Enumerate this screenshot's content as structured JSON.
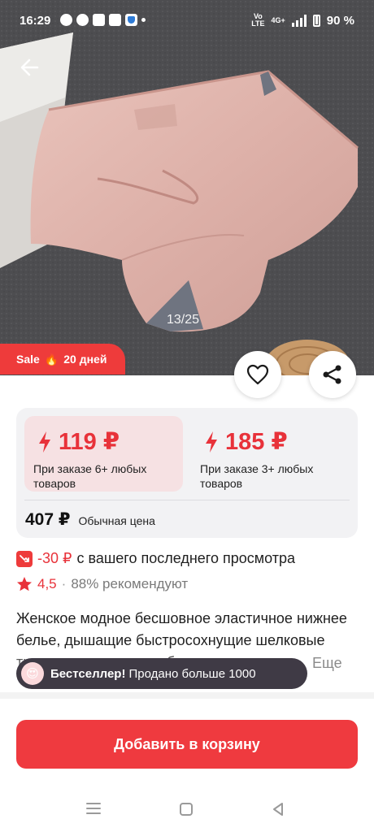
{
  "status_bar": {
    "time": "16:29",
    "volte_top": "Vo",
    "volte_bottom": "LTE",
    "network": "4G+",
    "battery": "90 %"
  },
  "gallery": {
    "counter": "13/25"
  },
  "sale_badge": {
    "label": "Sale",
    "icon": "fire-emoji",
    "fire": "🔥",
    "days": "20 дней"
  },
  "actions": {
    "favorite_icon": "heart-icon",
    "share_icon": "share-icon"
  },
  "pricing": {
    "tiers": [
      {
        "price": "119 ₽",
        "note": "При заказе 6+ любых товаров",
        "icon": "lightning-icon"
      },
      {
        "price": "185 ₽",
        "note": "При заказе 3+ любых товаров",
        "icon": "lightning-icon"
      }
    ],
    "regular_price": "407 ₽",
    "regular_label": "Обычная цена"
  },
  "price_drop": {
    "value": "-30 ₽",
    "text": "с вашего последнего просмотра"
  },
  "rating": {
    "value": "4,5",
    "separator": "·",
    "recommend": "88% рекомендуют"
  },
  "description": {
    "text": "Женское модное бесшовное эластичное нижнее белье, дышащие быстросохнущие шелковые трусики со льдом, удобн…",
    "more": "Еще"
  },
  "bestseller": {
    "emoji": "😍",
    "title": "Бестселлер!",
    "text": "Продано больше 1000"
  },
  "cart_button": {
    "label": "Добавить в корзину"
  },
  "colors": {
    "accent": "#ee3b3b",
    "tier_bg": "#f6e1e3",
    "card_bg": "#f2f2f4",
    "toast_bg": "#3f3a45"
  }
}
